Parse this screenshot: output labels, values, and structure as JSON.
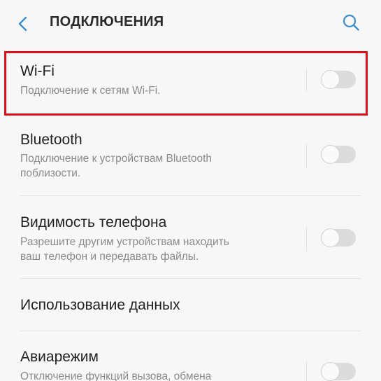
{
  "header": {
    "title": "ПОДКЛЮЧЕНИЯ",
    "back_icon": "chevron-left-icon",
    "search_icon": "search-icon",
    "accent_color": "#3a8fd0"
  },
  "items": [
    {
      "title": "Wi-Fi",
      "subtitle_lines": [
        "Подключение к сетям Wi-Fi."
      ],
      "toggle_on": false
    },
    {
      "title": "Bluetooth",
      "subtitle_lines": [
        "Подключение к устройствам Bluetooth",
        "поблизости."
      ],
      "toggle_on": false
    },
    {
      "title": "Видимость телефона",
      "subtitle_lines": [
        "Разрешите другим устройствам находить",
        "ваш телефон и передавать файлы."
      ],
      "toggle_on": false
    },
    {
      "title": "Использование данных"
    },
    {
      "title": "Авиарежим",
      "subtitle_lines": [
        "Отключение функций вызова, обмена"
      ],
      "toggle_on": false
    }
  ],
  "highlight_color": "#e1111a"
}
